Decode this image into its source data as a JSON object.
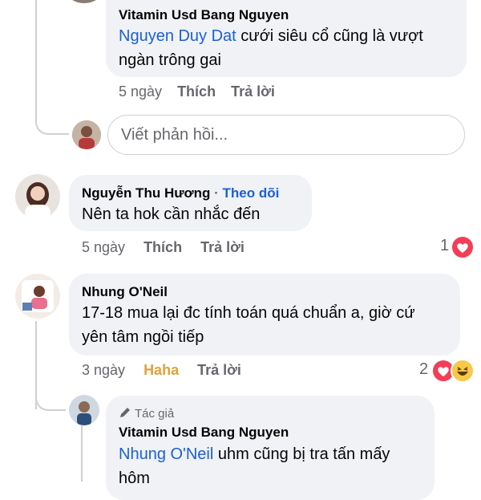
{
  "comments": [
    {
      "author": "Vitamin Usd Bang Nguyen",
      "mention": "Nguyen Duy Dat",
      "text_line1": " cưới siêu cổ cũng là vượt",
      "text_line2": "ngàn trông gai",
      "time": "5 ngày",
      "like_label": "Thích",
      "reply_label": "Trả lời"
    },
    {
      "author": "Nguyễn Thu Hương",
      "separator": " · ",
      "follow_label": "Theo dõi",
      "text": "Nên ta hok cần nhắc đến",
      "time": "5 ngày",
      "like_label": "Thích",
      "reply_label": "Trả lời",
      "reaction_count": "1",
      "reactions": [
        "heart-icon"
      ]
    },
    {
      "author": "Nhung O'Neil",
      "text_line1": "17-18 mua lại đc tính toán quá chuẩn a, giờ cứ",
      "text_line2": "yên tâm ngồi tiếp",
      "time": "3 ngày",
      "like_label": "Haha",
      "reply_label": "Trả lời",
      "reaction_count": "2",
      "reactions": [
        "heart-icon",
        "haha-icon"
      ]
    },
    {
      "badge": "Tác giả",
      "author": "Vitamin Usd Bang Nguyen",
      "mention": "Nhung O'Neil",
      "text_line1": " uhm cũng bị tra tấn mấy",
      "text_line2": "hôm"
    }
  ],
  "reply_box": {
    "placeholder": "Viết phản hồi..."
  },
  "colors": {
    "link": "#1b5fd6",
    "bubble": "#f0f2f5",
    "meta": "#65676b",
    "haha": "#e0a23a",
    "heart": "#f33e58"
  }
}
